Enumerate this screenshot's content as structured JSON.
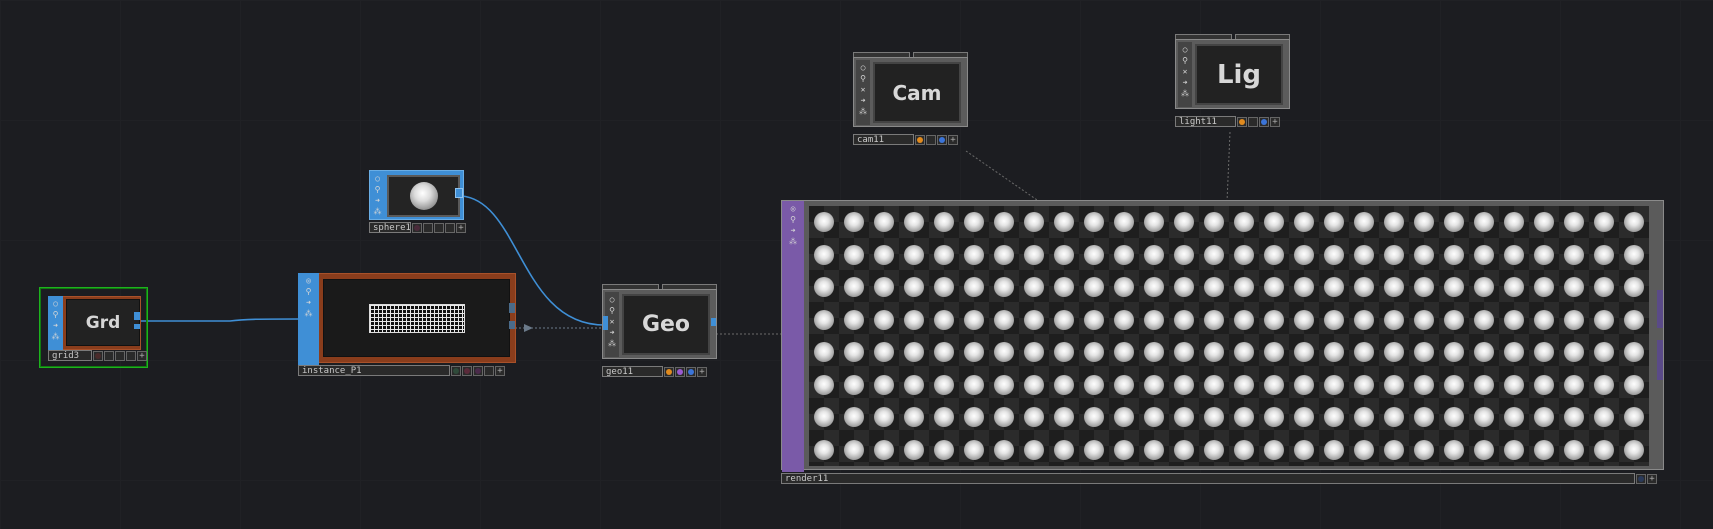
{
  "nodes": {
    "grid": {
      "title": "Grd",
      "name": "grid3"
    },
    "sphere": {
      "name": "sphere1"
    },
    "instance": {
      "name": "instance_P1"
    },
    "geo": {
      "title": "Geo",
      "name": "geo11"
    },
    "cam": {
      "title": "Cam",
      "name": "cam11"
    },
    "light": {
      "title": "Lig",
      "name": "light11"
    },
    "render": {
      "name": "render11"
    }
  },
  "render_preview": {
    "rows": 8,
    "columns": 28
  },
  "colors": {
    "background": "#1c1d21",
    "sop_family": "#3f8fd6",
    "comp_family": "#6b6b6b",
    "top_family": "#7a5aa8",
    "instance_border": "#8a3d1c",
    "selected": "#1db31d",
    "wire_sop": "#3f8fd6",
    "flag_orange": "#e08a1e",
    "flag_purple": "#9a5ad0",
    "flag_blue": "#3b74d8"
  },
  "icons": [
    "circle-icon",
    "pin-icon",
    "close-icon",
    "arrow-icon",
    "bug-icon",
    "plus-icon"
  ]
}
